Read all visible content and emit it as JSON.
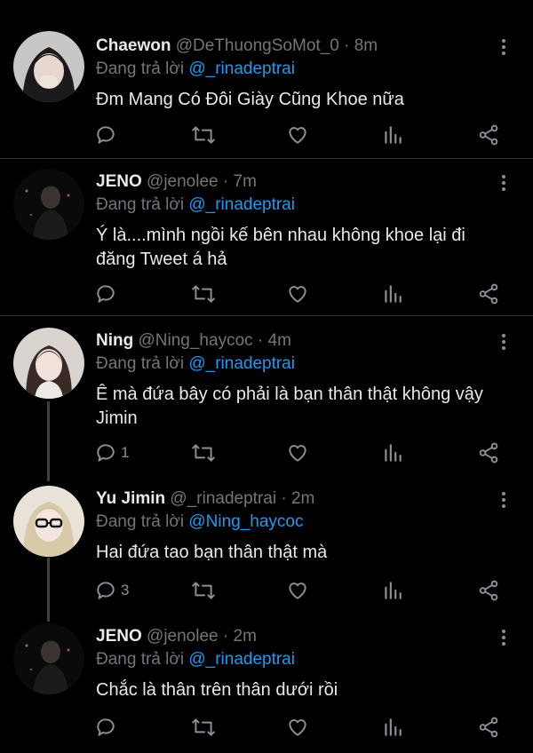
{
  "tweets": [
    {
      "name": "Chaewon",
      "handle": "@DeThuongSoMot_0",
      "time": "8m",
      "reply_prefix": "Đang trả lời",
      "reply_to": "@_rinadeptrai",
      "text": "Đm Mang Có Đôi Giày Cũng Khoe nữa",
      "reply_count": "",
      "avatar_icon": "avatar-girl-dark-hair"
    },
    {
      "name": "JENO",
      "handle": "@jenolee",
      "time": "7m",
      "reply_prefix": "Đang trả lời",
      "reply_to": "@_rinadeptrai",
      "text_lines": [
        "Ý là....mình ngồi kế bên nhau không khoe lại đi",
        "đăng Tweet á hả"
      ],
      "reply_count": "",
      "avatar_icon": "avatar-boy-night"
    },
    {
      "name": "Ning",
      "handle": "@Ning_haycoc",
      "time": "4m",
      "reply_prefix": "Đang trả lời",
      "reply_to": "@_rinadeptrai",
      "text_lines": [
        "Ê mà đứa bây có phải là bạn thân thật không vậy",
        "Jimin"
      ],
      "reply_count": "1",
      "avatar_icon": "avatar-girl-light"
    },
    {
      "name": "Yu Jimin",
      "handle": "@_rinadeptrai",
      "time": "2m",
      "reply_prefix": "Đang trả lời",
      "reply_to": "@Ning_haycoc",
      "text": "Hai đứa tao bạn thân thật mà",
      "reply_count": "3",
      "avatar_icon": "avatar-girl-glasses"
    },
    {
      "name": "JENO",
      "handle": "@jenolee",
      "time": "2m",
      "reply_prefix": "Đang trả lời",
      "reply_to": "@_rinadeptrai",
      "text": "Chắc là thân trên thân dưới rồi",
      "reply_count": "",
      "avatar_icon": "avatar-boy-night"
    }
  ],
  "separator": "·",
  "colors": {
    "background": "#000000",
    "link": "#1d9bf0",
    "muted": "#71767b",
    "text": "#e7e9ea"
  }
}
